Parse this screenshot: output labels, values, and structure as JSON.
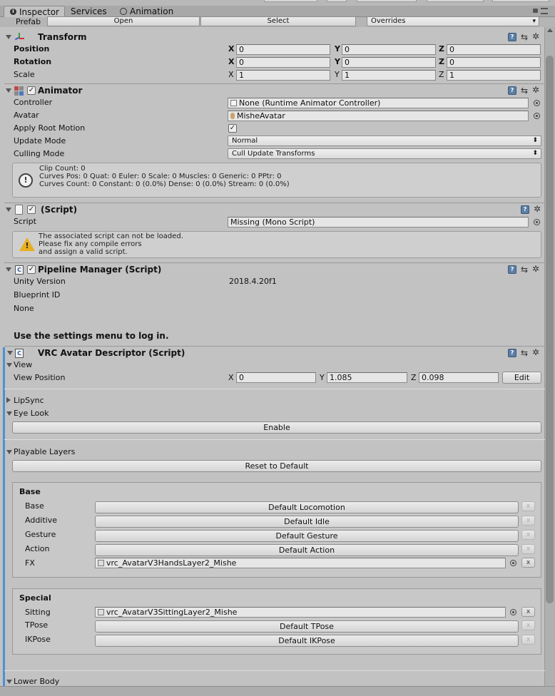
{
  "tabs": [
    {
      "label": "Inspector",
      "active": true
    },
    {
      "label": "Services",
      "active": false
    },
    {
      "label": "Animation",
      "active": false
    }
  ],
  "prefab": {
    "label": "Prefab",
    "open": "Open",
    "select": "Select",
    "overrides": "Overrides"
  },
  "transform": {
    "title": "Transform",
    "rows": [
      {
        "label": "Position",
        "bold": true,
        "x": "0",
        "y": "0",
        "z": "0"
      },
      {
        "label": "Rotation",
        "bold": true,
        "x": "0",
        "y": "0",
        "z": "0"
      },
      {
        "label": "Scale",
        "bold": false,
        "x": "1",
        "y": "1",
        "z": "1"
      }
    ]
  },
  "axis": {
    "x": "X",
    "y": "Y",
    "z": "Z"
  },
  "animator": {
    "title": "Animator",
    "controller_label": "Controller",
    "controller_value": "None (Runtime Animator Controller)",
    "avatar_label": "Avatar",
    "avatar_value": "MisheAvatar",
    "root_motion_label": "Apply Root Motion",
    "root_motion_checked": true,
    "update_mode_label": "Update Mode",
    "update_mode_value": "Normal",
    "culling_mode_label": "Culling Mode",
    "culling_mode_value": "Cull Update Transforms",
    "info": "Clip Count: 0\nCurves Pos: 0 Quat: 0 Euler: 0 Scale: 0 Muscles: 0 Generic: 0 PPtr: 0\nCurves Count: 0 Constant: 0 (0.0%) Dense: 0 (0.0%) Stream: 0 (0.0%)"
  },
  "missing_script": {
    "title": "(Script)",
    "script_label": "Script",
    "script_value": "Missing (Mono Script)",
    "warning": "The associated script can not be loaded.\nPlease fix any compile errors\nand assign a valid script."
  },
  "pipeline": {
    "title": "Pipeline Manager (Script)",
    "unity_version_label": "Unity Version",
    "unity_version_value": "2018.4.20f1",
    "blueprint_label": "Blueprint ID",
    "none_label": "None",
    "login_text": "Use the settings menu to log in."
  },
  "vrc": {
    "title": "VRC Avatar Descriptor (Script)",
    "view_label": "View",
    "view_position_label": "View Position",
    "view_x": "0",
    "view_y": "1.085",
    "view_z": "0.098",
    "edit_label": "Edit",
    "lipsync_label": "LipSync",
    "eyelook_label": "Eye Look",
    "enable_label": "Enable",
    "playable_label": "Playable Layers",
    "reset_label": "Reset to Default",
    "base_group": {
      "title": "Base",
      "rows": [
        {
          "label": "Base",
          "value": "Default Locomotion",
          "type": "button"
        },
        {
          "label": "Additive",
          "value": "Default Idle",
          "type": "button"
        },
        {
          "label": "Gesture",
          "value": "Default Gesture",
          "type": "button"
        },
        {
          "label": "Action",
          "value": "Default Action",
          "type": "button"
        },
        {
          "label": "FX",
          "value": "vrc_AvatarV3HandsLayer2_Mishe",
          "type": "field"
        }
      ]
    },
    "special_group": {
      "title": "Special",
      "rows": [
        {
          "label": "Sitting",
          "value": "vrc_AvatarV3SittingLayer2_Mishe",
          "type": "field"
        },
        {
          "label": "TPose",
          "value": "Default TPose",
          "type": "button"
        },
        {
          "label": "IKPose",
          "value": "Default IKPose",
          "type": "button"
        }
      ]
    },
    "lower_body_label": "Lower Body",
    "x_glyph": "x"
  },
  "glyphs": {
    "dropdown": "▾",
    "check": "✓",
    "help": "?",
    "preset": "⇆",
    "gear": "✲",
    "warning": "!",
    "info": "!"
  }
}
